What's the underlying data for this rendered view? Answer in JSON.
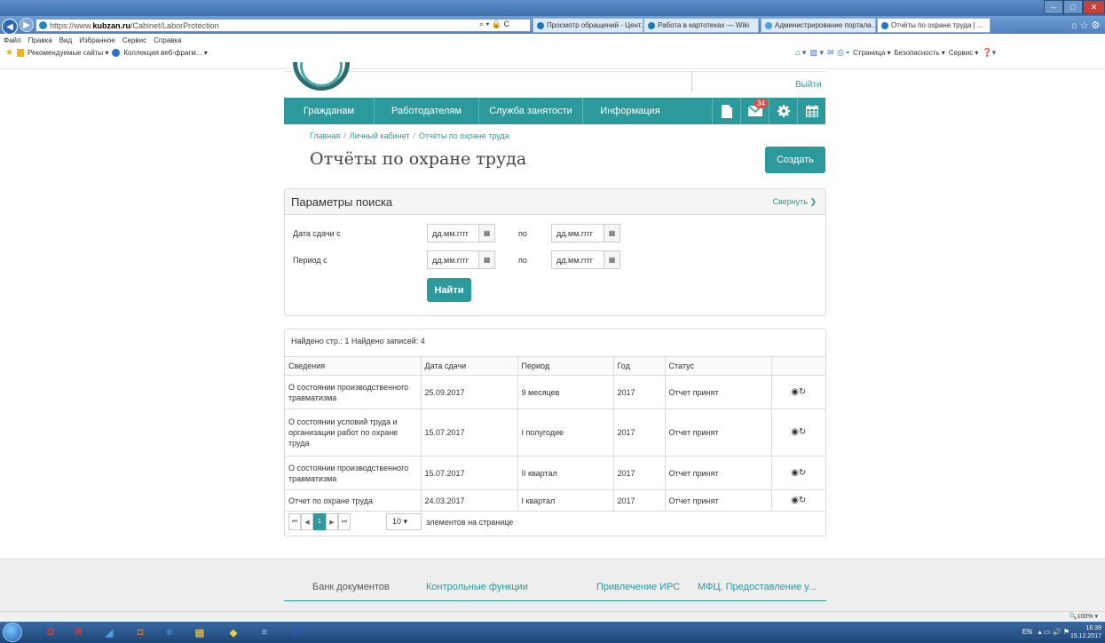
{
  "browser": {
    "url_proto": "https://www.",
    "url_host": "kubzan.ru",
    "url_path": "/Cabinet/LaborProtection",
    "url_controls": "⌕ ▾ 🔒 C",
    "tabs": [
      {
        "label": "Просмотр обращений - Цент..."
      },
      {
        "label": "Работа в картотеках — Wiki"
      },
      {
        "label": "Администрирование портала..."
      },
      {
        "label": "Отчёты по охране труда | ...",
        "close": "✕"
      }
    ],
    "menu": [
      "Файл",
      "Правка",
      "Вид",
      "Избранное",
      "Сервис",
      "Справка"
    ],
    "favorites": {
      "recommended": "Рекомендуемые сайты ▾",
      "collection": "Коллекция веб-фрагм... ▾"
    },
    "toolbar_right": [
      "Страница ▾",
      "Безопасность ▾",
      "Сервис ▾"
    ],
    "window_controls": {
      "min": "–",
      "max": "□",
      "close": "✕"
    },
    "chrome_icons": "⌂☆⚙",
    "zoom": "🔍100% ▾"
  },
  "header": {
    "logout": "Выйти"
  },
  "nav": {
    "items": [
      "Гражданам",
      "Работодателям",
      "Служба занятости",
      "Информация"
    ],
    "mail_badge": "34"
  },
  "breadcrumb": [
    "Главная",
    "Личный кабинет",
    "Отчёты по охране труда"
  ],
  "page_title": "Отчёты по охране труда",
  "create_label": "Создать",
  "search": {
    "title": "Параметры поиска",
    "collapse_label": "Свернуть ❯",
    "submit_label": "Найти",
    "date_from_label": "Дата сдачи с",
    "period_from_label": "Период с",
    "to_label": "по",
    "placeholder": "дд.мм.гггг"
  },
  "results": {
    "summary": "Найдено стр.: 1 Найдено записей: 4",
    "columns": [
      "Сведения",
      "Дата сдачи",
      "Период",
      "Год",
      "Статус"
    ],
    "rows": [
      {
        "info": "О состоянии производственного травматизма",
        "date": "25.09.2017",
        "period": "9 месяцев",
        "year": "2017",
        "status": "Отчет принят"
      },
      {
        "info": "О состоянии условий труда и организации работ по охране труда",
        "date": "15.07.2017",
        "period": "I полугодие",
        "year": "2017",
        "status": "Отчет принят"
      },
      {
        "info": "О состоянии производственного травматизма",
        "date": "15.07.2017",
        "period": "II квартал",
        "year": "2017",
        "status": "Отчет принят"
      },
      {
        "info": "Отчет по охране труда",
        "date": "24.03.2017",
        "period": "I квартал",
        "year": "2017",
        "status": "Отчет принят"
      }
    ],
    "pager": {
      "first": "⏮",
      "prev": "◀",
      "current": "1",
      "next": "▶",
      "last": "⏭"
    },
    "page_size": "10 ▾",
    "page_size_label": "элементов на странице"
  },
  "footer": {
    "links": [
      "Банк документов",
      "Контрольные функции",
      "Привлечение ИРС",
      "МФЦ. Предоставление у..."
    ]
  },
  "taskbar": {
    "lang": "EN",
    "time": "16:39",
    "date": "15.12.2017",
    "icons": [
      {
        "glyph": "O",
        "color": "#e03a2e"
      },
      {
        "glyph": "Я",
        "color": "#e03a2e"
      },
      {
        "glyph": "◢",
        "color": "#4aa3e0"
      },
      {
        "glyph": "◘",
        "color": "#f07a1e"
      },
      {
        "glyph": "e",
        "color": "#3b8de0"
      },
      {
        "glyph": "▤",
        "color": "#f0c040"
      },
      {
        "glyph": "◆",
        "color": "#f0d040"
      },
      {
        "glyph": "≡",
        "color": "#c0c8d0"
      },
      {
        "glyph": "W",
        "color": "#2a5cb8"
      }
    ]
  },
  "colors": {
    "accent": "#2c9a9d",
    "badge": "#e24b40"
  }
}
